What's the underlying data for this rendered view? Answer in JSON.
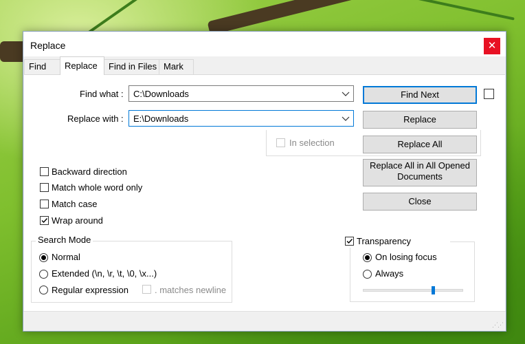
{
  "dialog": {
    "title": "Replace",
    "close_icon": "close-icon"
  },
  "tabs": [
    {
      "label": "Find"
    },
    {
      "label": "Replace"
    },
    {
      "label": "Find in Files"
    },
    {
      "label": "Mark"
    }
  ],
  "find": {
    "label": "Find what :",
    "value": "C:\\Downloads"
  },
  "replace": {
    "label": "Replace with :",
    "value": "E:\\Downloads"
  },
  "buttons": {
    "find_next": "Find Next",
    "replace": "Replace",
    "replace_all": "Replace All",
    "replace_all_opened_line1": "Replace All in All Opened",
    "replace_all_opened_line2": "Documents",
    "close": "Close"
  },
  "in_selection": {
    "label": "In selection",
    "checked": false,
    "enabled": false
  },
  "options": [
    {
      "label": "Backward direction",
      "checked": false
    },
    {
      "label": "Match whole word only",
      "checked": false
    },
    {
      "label": "Match case",
      "checked": false
    },
    {
      "label": "Wrap around",
      "checked": true
    }
  ],
  "search_mode": {
    "title": "Search Mode",
    "options": [
      {
        "label": "Normal",
        "selected": true
      },
      {
        "label": "Extended (\\n, \\r, \\t, \\0, \\x...)",
        "selected": false
      },
      {
        "label": "Regular expression",
        "selected": false
      }
    ],
    "matches_newline": {
      "label": ". matches newline",
      "checked": false,
      "enabled": false
    }
  },
  "transparency": {
    "label": "Transparency",
    "checked": true,
    "options": [
      {
        "label": "On losing focus",
        "selected": true
      },
      {
        "label": "Always",
        "selected": false
      }
    ],
    "slider_fraction": 0.7
  },
  "colors": {
    "accent": "#0078d7",
    "close": "#e81123"
  }
}
